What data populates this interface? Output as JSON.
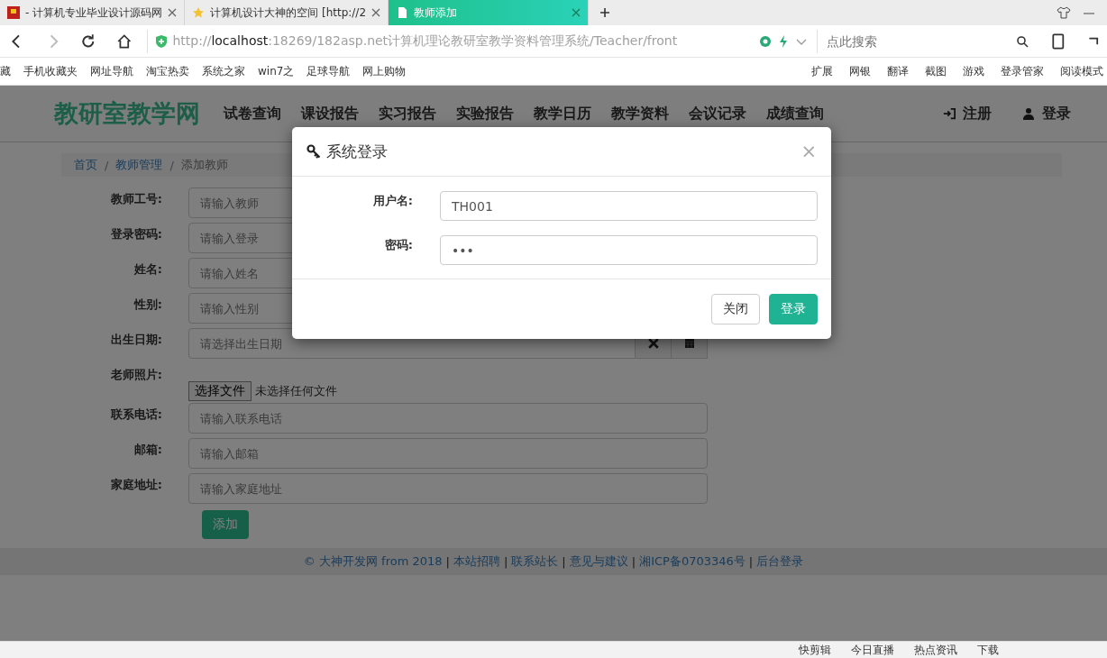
{
  "browser": {
    "tabs": [
      {
        "title": "- 计算机专业毕业设计源码网",
        "selected": false
      },
      {
        "title": "计算机设计大神的空间 [http://2",
        "selected": false
      },
      {
        "title": "教师添加",
        "selected": true
      }
    ],
    "address": {
      "scheme": "http://",
      "host": "localhost",
      "path": ":18269/182asp.net计算机理论教研室教学资料管理系统/Teacher/front"
    },
    "search_placeholder": "点此搜索",
    "bookmarks": [
      "藏",
      "手机收藏夹",
      "网址导航",
      "淘宝热卖",
      "系统之家",
      "win7之",
      "足球导航",
      "网上购物"
    ],
    "tools": [
      "扩展",
      "网银",
      "翻译",
      "截图",
      "游戏",
      "登录管家",
      "阅读模式"
    ],
    "status_items": [
      "快剪辑",
      "今日直播",
      "热点资讯",
      "下载"
    ]
  },
  "site": {
    "logo": "教研室教学网",
    "nav": [
      "试卷查询",
      "课设报告",
      "实习报告",
      "实验报告",
      "教学日历",
      "教学资料",
      "会议记录",
      "成绩查询"
    ],
    "user_links": [
      {
        "label": "注册",
        "kind": "register"
      },
      {
        "label": "登录",
        "kind": "login"
      }
    ],
    "breadcrumb_separator": "/",
    "breadcrumb": [
      {
        "label": "首页",
        "link": true
      },
      {
        "label": "教师管理",
        "link": true
      },
      {
        "label": "添加教师",
        "link": false
      }
    ],
    "form": [
      {
        "label": "教师工号:",
        "kind": "text",
        "placeholder": "请输入教师"
      },
      {
        "label": "登录密码:",
        "kind": "text",
        "placeholder": "请输入登录"
      },
      {
        "label": "姓名:",
        "kind": "text",
        "placeholder": "请输入姓名"
      },
      {
        "label": "性别:",
        "kind": "text",
        "placeholder": "请输入性别"
      },
      {
        "label": "出生日期:",
        "kind": "date",
        "placeholder": "请选择出生日期"
      },
      {
        "label": "老师照片:",
        "kind": "file",
        "button": "选择文件",
        "note": "未选择任何文件"
      },
      {
        "label": "联系电话:",
        "kind": "text",
        "placeholder": "请输入联系电话"
      },
      {
        "label": "邮箱:",
        "kind": "text",
        "placeholder": "请输入邮箱"
      },
      {
        "label": "家庭地址:",
        "kind": "text",
        "placeholder": "请输入家庭地址"
      }
    ],
    "submit": "添加",
    "footer": {
      "copyright": "© 大神开发网 from 2018",
      "separator": "|",
      "links": [
        "本站招聘",
        "联系站长",
        "意见与建议",
        "湘ICP备0703346号",
        "后台登录"
      ]
    }
  },
  "modal": {
    "title": "系统登录",
    "close": "×",
    "fields": [
      {
        "label": "用户名:",
        "value": "TH001"
      },
      {
        "label": "密码:",
        "value": "•••"
      }
    ],
    "buttons": [
      {
        "label": "关闭",
        "kind": "default"
      },
      {
        "label": "登录",
        "kind": "primary"
      }
    ]
  }
}
